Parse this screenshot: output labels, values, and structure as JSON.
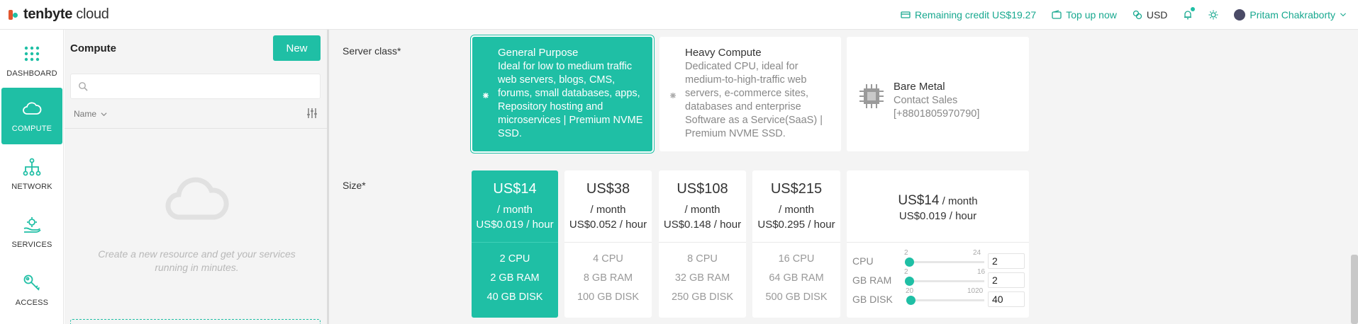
{
  "brand": {
    "bold": "tenbyte",
    "light": " cloud"
  },
  "topbar": {
    "credit": "Remaining credit US$19.27",
    "topup": "Top up now",
    "currency": "USD",
    "user": "Pritam Chakraborty"
  },
  "nav": [
    {
      "label": "DASHBOARD",
      "icon": "grid-icon"
    },
    {
      "label": "COMPUTE",
      "icon": "cloud-icon"
    },
    {
      "label": "NETWORK",
      "icon": "network-icon"
    },
    {
      "label": "SERVICES",
      "icon": "services-icon"
    },
    {
      "label": "ACCESS",
      "icon": "key-icon"
    }
  ],
  "sidepanel": {
    "title": "Compute",
    "new_label": "New",
    "search_placeholder": "",
    "column_header": "Name",
    "empty_text": "Create a new resource and get your services running in minutes."
  },
  "server_class": {
    "label": "Server class*",
    "options": [
      {
        "title": "General Purpose",
        "desc": "Ideal for low to medium traffic web servers, blogs, CMS, forums, small databases, apps, Repository hosting and microservices | Premium NVME SSD.",
        "selected": true
      },
      {
        "title": "Heavy Compute",
        "desc": "Dedicated CPU, ideal for medium-to-high-traffic web servers, e-commerce sites, databases and enterprise Software as a Service(SaaS) | Premium NVME SSD.",
        "selected": false
      }
    ],
    "bare_metal": {
      "title": "Bare Metal",
      "line1": "Contact Sales",
      "line2": "[+8801805970790]"
    }
  },
  "size": {
    "label": "Size*",
    "plans": [
      {
        "price": "US$14",
        "month": "/ month",
        "hour": "US$0.019 / hour",
        "cpu": "2 CPU",
        "ram": "2 GB RAM",
        "disk": "40 GB DISK",
        "selected": true
      },
      {
        "price": "US$38",
        "month": "/ month",
        "hour": "US$0.052 / hour",
        "cpu": "4 CPU",
        "ram": "8 GB RAM",
        "disk": "100 GB DISK",
        "selected": false
      },
      {
        "price": "US$108",
        "month": "/ month",
        "hour": "US$0.148 / hour",
        "cpu": "8 CPU",
        "ram": "32 GB RAM",
        "disk": "250 GB DISK",
        "selected": false
      },
      {
        "price": "US$215",
        "month": "/ month",
        "hour": "US$0.295 / hour",
        "cpu": "16 CPU",
        "ram": "64 GB RAM",
        "disk": "500 GB DISK",
        "selected": false
      }
    ],
    "custom": {
      "price": "US$14",
      "month": " / month",
      "hour": "US$0.019 / hour",
      "sliders": [
        {
          "label": "CPU",
          "min": "2",
          "max": "24",
          "value": "2",
          "fraction": 0
        },
        {
          "label": "GB RAM",
          "min": "2",
          "max": "16",
          "value": "2",
          "fraction": 0
        },
        {
          "label": "GB DISK",
          "min": "20",
          "max": "1020",
          "value": "40",
          "fraction": 0.02
        }
      ]
    }
  },
  "colors": {
    "accent": "#1fbfa5",
    "logo_red": "#e2562f"
  }
}
